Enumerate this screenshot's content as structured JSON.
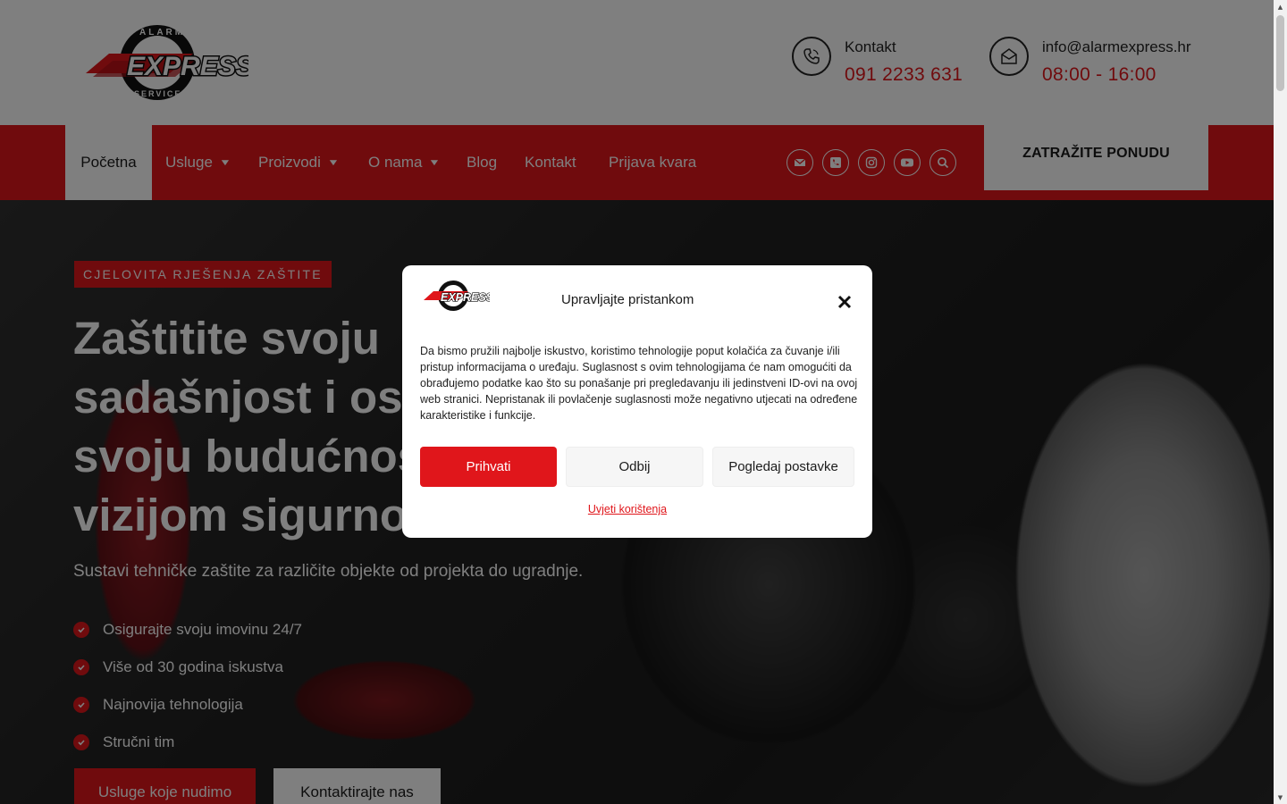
{
  "header": {
    "logo_alt": "Alarm Express Service",
    "contact": {
      "label": "Kontakt",
      "value": "091 2233 631",
      "icon": "phone-icon"
    },
    "hours": {
      "label": "info@alarmexpress.hr",
      "value": "08:00 - 16:00",
      "icon": "mail-open-icon"
    }
  },
  "nav": {
    "items": [
      {
        "label": "Početna",
        "active": true
      },
      {
        "label": "Usluge",
        "dropdown": true
      },
      {
        "label": "Proizvodi",
        "dropdown": true
      },
      {
        "label": "O nama",
        "dropdown": true
      },
      {
        "label": "Blog"
      },
      {
        "label": "Kontakt"
      },
      {
        "label": " Prijava kvara"
      }
    ],
    "social_icons": [
      "envelope-icon",
      "phone-icon",
      "instagram-icon",
      "youtube-icon",
      "search-icon"
    ],
    "cta_label": "ZATRAŽITE PONUDU"
  },
  "hero": {
    "tagline": "CJELOVITA RJEŠENJA ZAŠTITE",
    "title_lines": [
      "Zaštitite svoju",
      "sadašnjost i osi",
      "svoju budućnos",
      "vizijom sigurno"
    ],
    "subtitle": "Sustavi tehničke zaštite za različite objekte od projekta do ugradnje.",
    "bullets": [
      "Osigurajte svoju imovinu 24/7",
      "Više od 30 godina iskustva",
      "Najnovija tehnologija",
      "Stručni tim"
    ],
    "primary_button": "Usluge koje nudimo",
    "secondary_button": "Kontaktirajte nas"
  },
  "consent_modal": {
    "title": "Upravljajte pristankom",
    "body": "Da bismo pružili najbolje iskustvo, koristimo tehnologije poput kolačića za čuvanje i/ili pristup informacijama o uređaju. Suglasnost s ovim tehnologijama će nam omogućiti da obrađujemo podatke kao što su ponašanje pri pregledavanju ili jedinstveni ID-ovi na ovoj web stranici. Nepristanak ili povlačenje suglasnosti može negativno utjecati na određene karakteristike i funkcije.",
    "accept_label": "Prihvati",
    "deny_label": "Odbij",
    "preferences_label": "Pogledaj postavke",
    "terms_link": "Uvjeti korištenja"
  },
  "colors": {
    "brand_red": "#e0161b",
    "text_dark": "#1b1b1b"
  }
}
